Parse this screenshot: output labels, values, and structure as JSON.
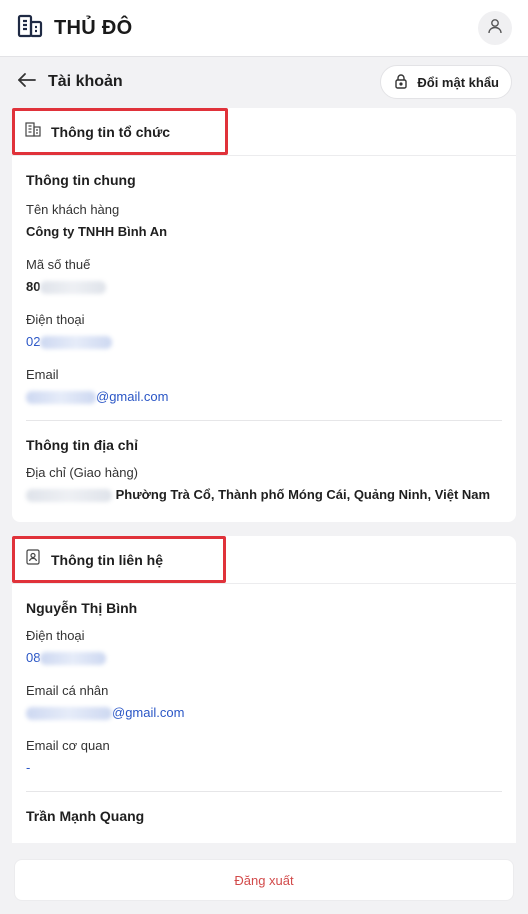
{
  "app": {
    "title": "THỦ ĐÔ"
  },
  "header": {
    "title": "Tài khoản",
    "change_password_label": "Đổi mật khẩu"
  },
  "org_card": {
    "title": "Thông tin tổ chức",
    "general": {
      "title": "Thông tin chung",
      "customer_name_label": "Tên khách hàng",
      "customer_name_value": "Công ty TNHH Bình An",
      "tax_code_label": "Mã số thuế",
      "tax_code_value": "80",
      "phone_label": "Điện thoại",
      "phone_value": "02",
      "email_label": "Email",
      "email_value": "@gmail.com"
    },
    "address": {
      "title": "Thông tin địa chỉ",
      "delivery_label": "Địa chỉ (Giao hàng)",
      "delivery_value": "Phường Trà Cổ, Thành phố Móng Cái, Quảng Ninh, Việt Nam"
    }
  },
  "contact_card": {
    "title": "Thông tin liên hệ",
    "contacts": [
      {
        "name": "Nguyễn Thị Bình",
        "phone_label": "Điện thoại",
        "phone_value": "08",
        "personal_email_label": "Email cá nhân",
        "personal_email_value": "@gmail.com",
        "work_email_label": "Email cơ quan",
        "work_email_value": "-"
      },
      {
        "name": "Trần Mạnh Quang"
      }
    ]
  },
  "footer": {
    "logout_label": "Đăng xuất"
  },
  "colors": {
    "accent_link": "#2a56c6",
    "logout_text": "#d24a4a",
    "highlight": "#e0323a",
    "background": "#f2f2f4"
  }
}
